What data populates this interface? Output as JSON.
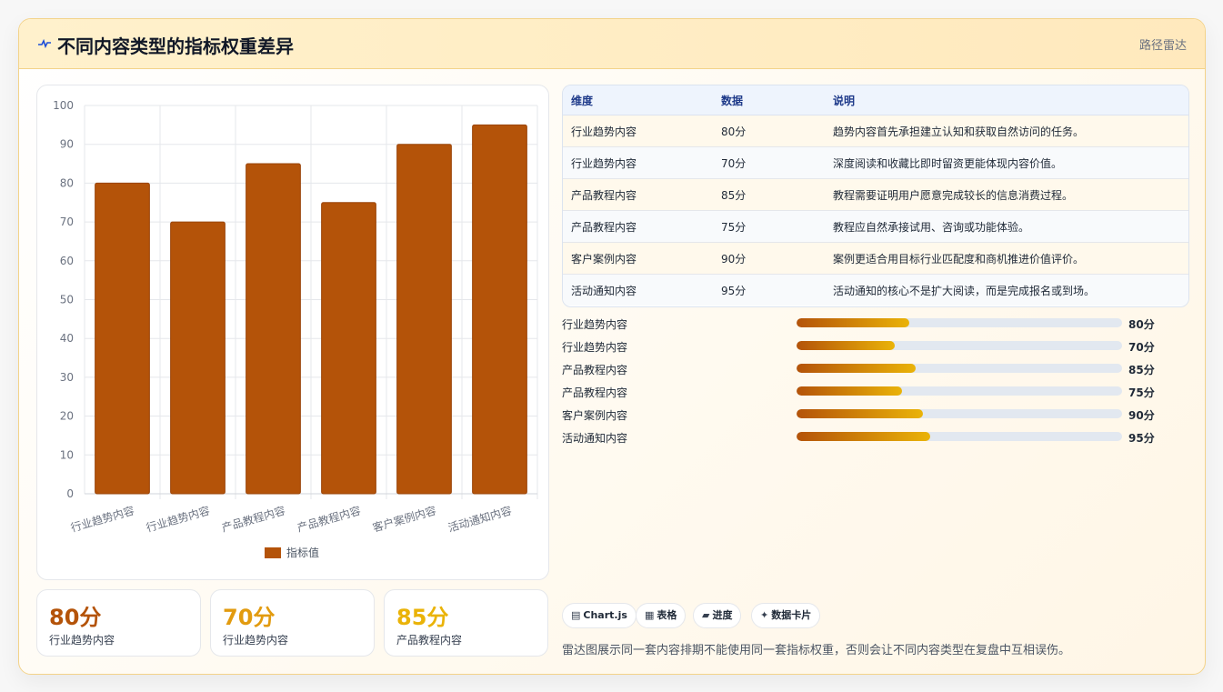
{
  "header": {
    "title": "不同内容类型的指标权重差异",
    "tag": "路径雷达",
    "icon": "pulse-icon"
  },
  "chart_data": {
    "type": "bar",
    "categories": [
      "行业趋势内容",
      "行业趋势内容",
      "产品教程内容",
      "产品教程内容",
      "客户案例内容",
      "活动通知内容"
    ],
    "series": [
      {
        "name": "指标值",
        "values": [
          80,
          70,
          85,
          75,
          90,
          95
        ]
      }
    ],
    "ylim": [
      0,
      100
    ],
    "yticks": [
      0,
      10,
      20,
      30,
      40,
      50,
      60,
      70,
      80,
      90,
      100
    ],
    "grid": true,
    "legend": "bottom",
    "color": "#b45309"
  },
  "table": {
    "headers": [
      "维度",
      "数据",
      "说明"
    ],
    "rows": [
      [
        "行业趋势内容",
        "80分",
        "趋势内容首先承担建立认知和获取自然访问的任务。"
      ],
      [
        "行业趋势内容",
        "70分",
        "深度阅读和收藏比即时留资更能体现内容价值。"
      ],
      [
        "产品教程内容",
        "85分",
        "教程需要证明用户愿意完成较长的信息消费过程。"
      ],
      [
        "产品教程内容",
        "75分",
        "教程应自然承接试用、咨询或功能体验。"
      ],
      [
        "客户案例内容",
        "90分",
        "案例更适合用目标行业匹配度和商机推进价值评价。"
      ],
      [
        "活动通知内容",
        "95分",
        "活动通知的核心不是扩大阅读，而是完成报名或到场。"
      ]
    ]
  },
  "progress": [
    {
      "label": "行业趋势内容",
      "value": "80分",
      "fraction": 0.345
    },
    {
      "label": "行业趋势内容",
      "value": "70分",
      "fraction": 0.302
    },
    {
      "label": "产品教程内容",
      "value": "85分",
      "fraction": 0.367
    },
    {
      "label": "产品教程内容",
      "value": "75分",
      "fraction": 0.324
    },
    {
      "label": "客户案例内容",
      "value": "90分",
      "fraction": 0.389
    },
    {
      "label": "活动通知内容",
      "value": "95分",
      "fraction": 0.41
    }
  ],
  "stats": [
    {
      "value": "80分",
      "label": "行业趋势内容",
      "color": "#b45309"
    },
    {
      "value": "70分",
      "label": "行业趋势内容",
      "color": "#e29b0f"
    },
    {
      "value": "85分",
      "label": "产品教程内容",
      "color": "#eab308"
    }
  ],
  "chips": [
    {
      "icon": "chart-icon",
      "glyph": "▤",
      "label": "Chart.js"
    },
    {
      "icon": "table-icon",
      "glyph": "▦",
      "label": "表格"
    },
    {
      "icon": "progress-icon",
      "glyph": "▰",
      "label": "进度"
    },
    {
      "icon": "sparkle-icon",
      "glyph": "✦",
      "label": "数据卡片"
    }
  ],
  "note": "雷达图展示同一套内容排期不能使用同一套指标权重，否则会让不同内容类型在复盘中互相误伤。"
}
